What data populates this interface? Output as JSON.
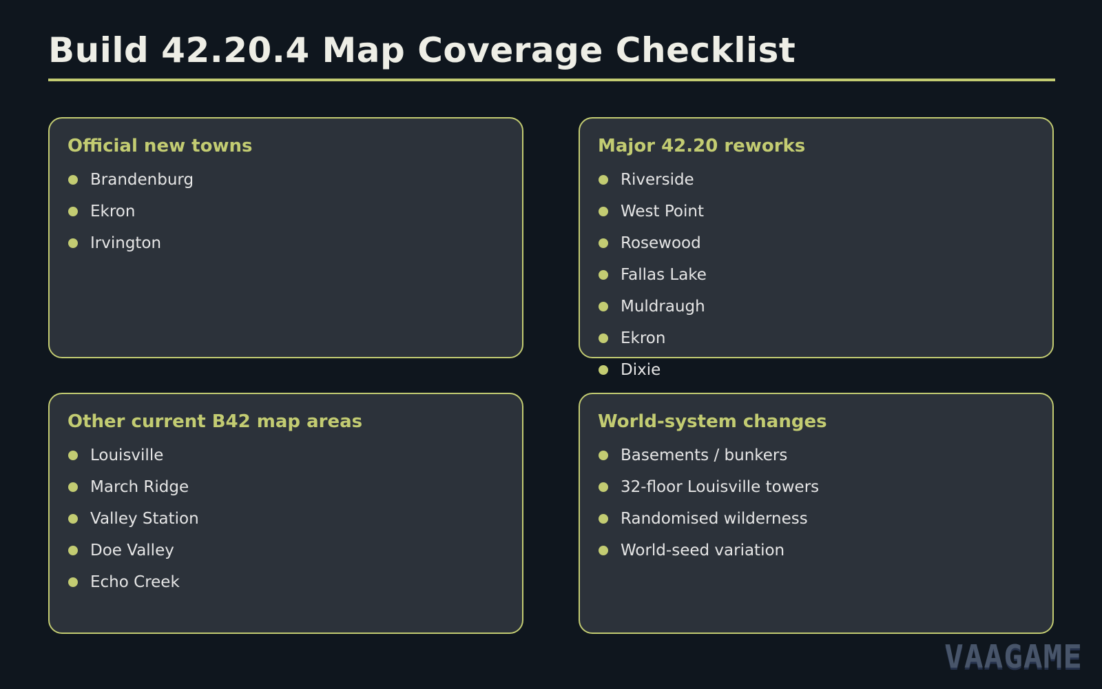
{
  "title": "Build 42.20.4 Map Coverage Checklist",
  "cards": {
    "official_new_towns": {
      "heading": "Official new towns",
      "items": [
        "Brandenburg",
        "Ekron",
        "Irvington"
      ]
    },
    "major_reworks": {
      "heading": "Major 42.20 reworks",
      "items": [
        "Riverside",
        "West Point",
        "Rosewood",
        "Fallas Lake",
        "Muldraugh",
        "Ekron",
        "Dixie"
      ]
    },
    "other_areas": {
      "heading": "Other current B42 map areas",
      "items": [
        "Louisville",
        "March Ridge",
        "Valley Station",
        "Doe Valley",
        "Echo Creek"
      ]
    },
    "world_system": {
      "heading": "World-system changes",
      "items": [
        "Basements / bunkers",
        "32-floor Louisville towers",
        "Randomised wilderness",
        "World-seed variation"
      ]
    }
  },
  "watermark": "VAAGAME",
  "colors": {
    "background": "#0f161e",
    "card": "#2c323a",
    "accent": "#c3cc72",
    "text": "#e6e6e6",
    "title": "#eeeee6"
  }
}
